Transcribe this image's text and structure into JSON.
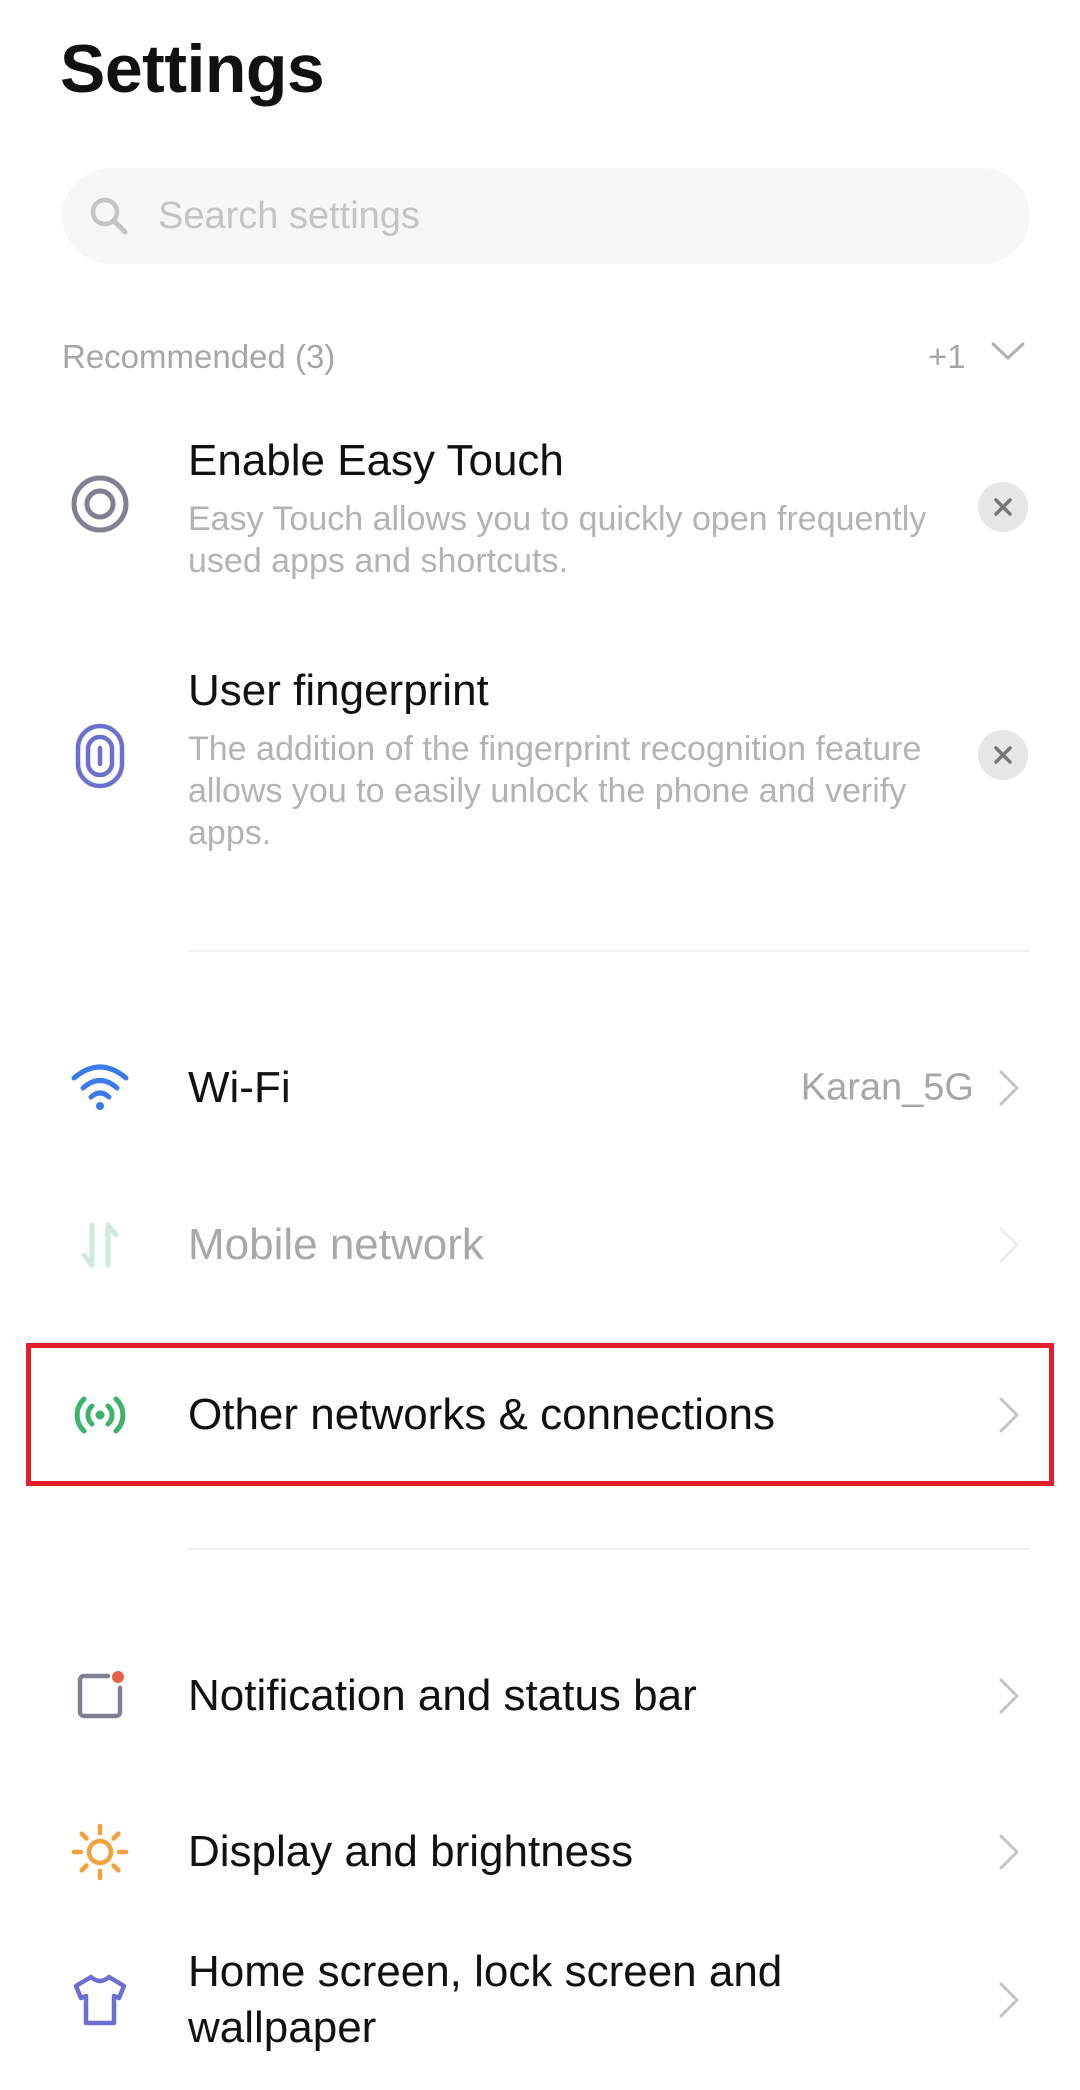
{
  "header": {
    "title": "Settings"
  },
  "search": {
    "placeholder": "Search settings"
  },
  "recommended": {
    "label": "Recommended (3)",
    "more_count": "+1",
    "cards": [
      {
        "title": "Enable Easy Touch",
        "description": "Easy Touch allows you to quickly open frequently used apps and shortcuts.",
        "icon": "easy-touch-icon"
      },
      {
        "title": "User fingerprint",
        "description": "The addition of the fingerprint recognition feature allows you to easily unlock the phone and verify apps.",
        "icon": "fingerprint-icon"
      }
    ]
  },
  "network_section": [
    {
      "label": "Wi-Fi",
      "value": "Karan_5G",
      "icon": "wifi-icon"
    },
    {
      "label": "Mobile network",
      "icon": "mobile-data-icon",
      "disabled": true
    },
    {
      "label": "Other networks & connections",
      "icon": "connections-icon"
    }
  ],
  "system_section": [
    {
      "label": "Notification and status bar",
      "icon": "notification-icon"
    },
    {
      "label": "Display and brightness",
      "icon": "brightness-icon"
    },
    {
      "label": "Home screen, lock screen and wallpaper",
      "icon": "theme-shirt-icon"
    }
  ],
  "colors": {
    "highlight": "#e31e2c",
    "wifi_icon": "#3a7bea",
    "connections_icon": "#3db469",
    "brightness_icon": "#f2a23c",
    "fingerprint_icon": "#6a6fd0",
    "notification_dot": "#e8604c"
  }
}
